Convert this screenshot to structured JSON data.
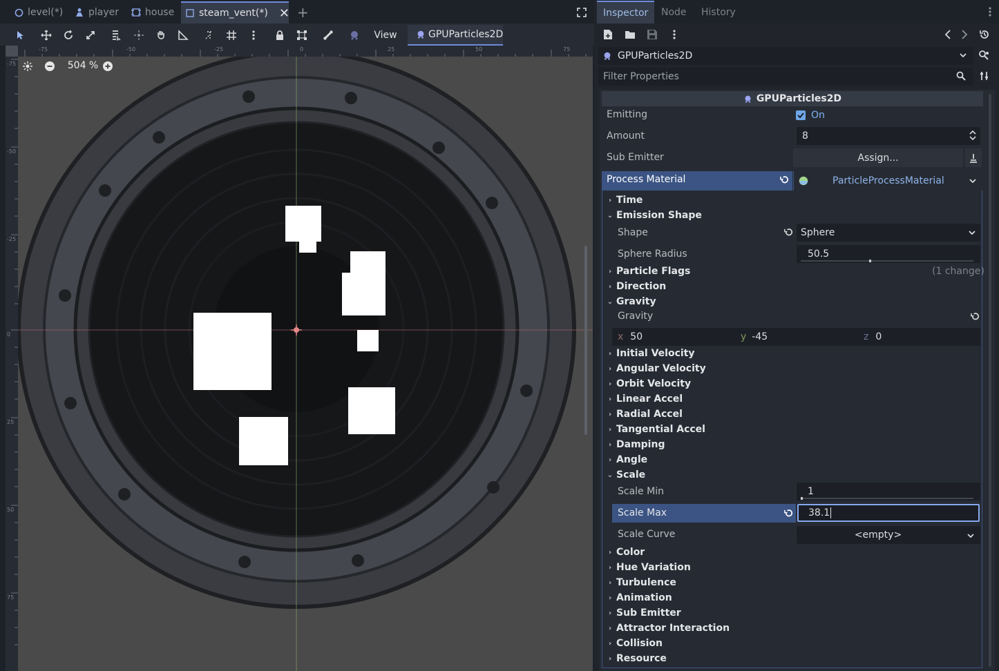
{
  "scene_tabs": [
    {
      "label": "level(*)",
      "icon": "circle-node-icon"
    },
    {
      "label": "player",
      "icon": "character-icon"
    },
    {
      "label": "house",
      "icon": "scene-frame-icon"
    },
    {
      "label": "steam_vent(*)",
      "icon": "scene-frame-icon"
    }
  ],
  "toolbar": {
    "view_label": "View",
    "node_button_label": "GPUParticles2D"
  },
  "viewport": {
    "zoom": "504 %",
    "ruler_h_labels": [
      "-75",
      "-50",
      "-25",
      "0",
      "25",
      "50",
      "75"
    ],
    "ruler_v_labels": [
      "-75",
      "-50",
      "-25",
      "0",
      "25",
      "50",
      "75"
    ]
  },
  "inspector": {
    "tabs": [
      "Inspector",
      "Node",
      "History"
    ],
    "node_path": "GPUParticles2D",
    "filter_placeholder": "Filter Properties",
    "class_header": "GPUParticles2D",
    "emitting_label": "Emitting",
    "emitting_value": "On",
    "amount_label": "Amount",
    "amount_value": "8",
    "sub_emitter_label": "Sub Emitter",
    "sub_emitter_value": "Assign...",
    "process_material_label": "Process Material",
    "process_material_value": "ParticleProcessMaterial",
    "sections": {
      "time": "Time",
      "emission_shape": "Emission Shape",
      "particle_flags": "Particle Flags",
      "particle_flags_note": "(1 change)",
      "direction": "Direction",
      "gravity": "Gravity",
      "initial_velocity": "Initial Velocity",
      "angular_velocity": "Angular Velocity",
      "orbit_velocity": "Orbit Velocity",
      "linear_accel": "Linear Accel",
      "radial_accel": "Radial Accel",
      "tangential_accel": "Tangential Accel",
      "damping": "Damping",
      "angle": "Angle",
      "scale": "Scale",
      "color": "Color",
      "hue_variation": "Hue Variation",
      "turbulence": "Turbulence",
      "animation": "Animation",
      "sub_emitter": "Sub Emitter",
      "attractor_interaction": "Attractor Interaction",
      "collision": "Collision",
      "resource": "Resource"
    },
    "shape_label": "Shape",
    "shape_value": "Sphere",
    "sphere_radius_label": "Sphere Radius",
    "sphere_radius_value": "50.5",
    "sphere_radius_slider_fraction": 0.4,
    "gravity_label": "Gravity",
    "gravity_x_axis": "x",
    "gravity_x": "50",
    "gravity_y_axis": "y",
    "gravity_y": "-45",
    "gravity_z_axis": "z",
    "gravity_z": "0",
    "scale_min_label": "Scale Min",
    "scale_min_value": "1",
    "scale_max_label": "Scale Max",
    "scale_max_value": "38.1",
    "scale_curve_label": "Scale Curve",
    "scale_curve_value": "<empty>"
  },
  "colors": {
    "accent": "#6e8cdc",
    "selected_row": "#3b5484",
    "field_bg": "#1c2026",
    "panel_bg": "#21252b"
  }
}
